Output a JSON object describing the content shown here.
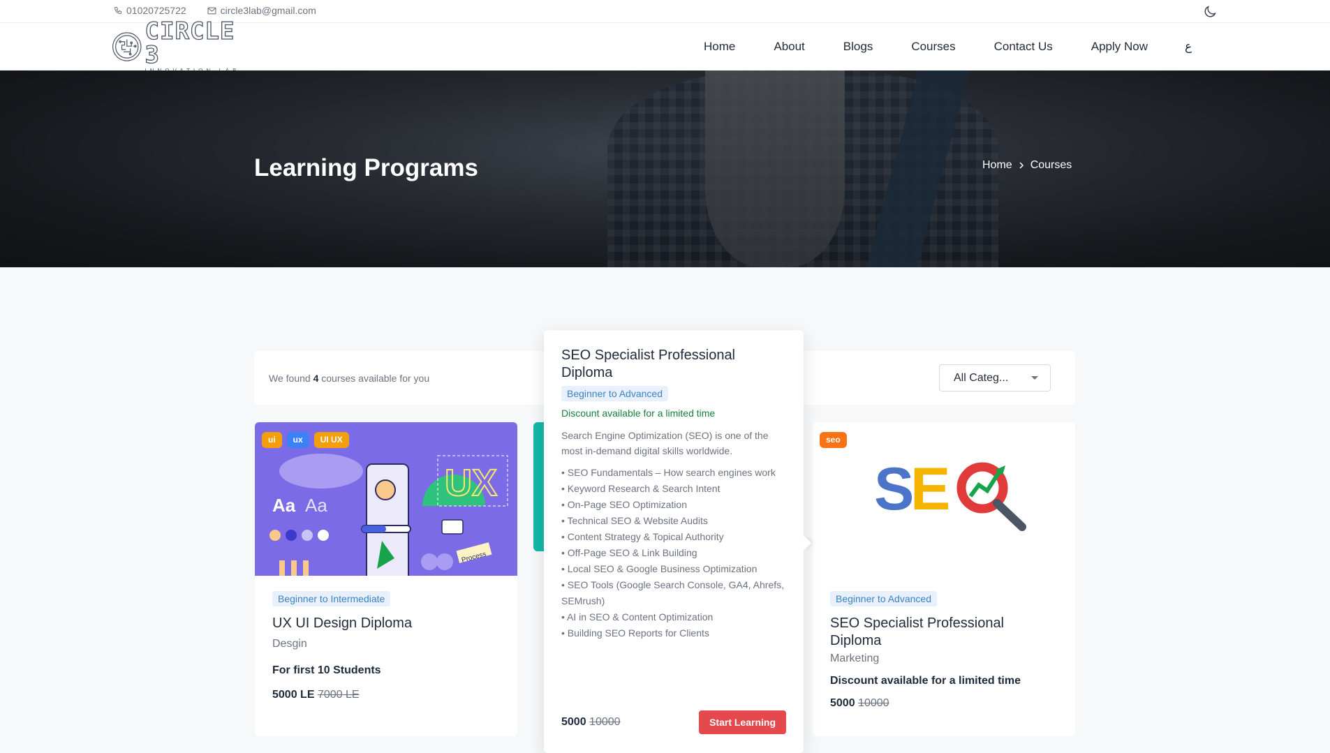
{
  "topbar": {
    "phone": "01020725722",
    "email": "circle3lab@gmail.com",
    "theme_toggle_icon": "moon-icon"
  },
  "logo": {
    "main": "CIRCLE 3",
    "sub": "INNOVATION LAB"
  },
  "nav": {
    "items": [
      "Home",
      "About",
      "Blogs",
      "Courses",
      "Contact Us",
      "Apply Now"
    ],
    "lang": "ع"
  },
  "hero": {
    "title": "Learning Programs",
    "breadcrumb": [
      "Home",
      "Courses"
    ]
  },
  "filter": {
    "found_prefix": "We found",
    "count": "4",
    "found_suffix": "courses available for you",
    "category_select": "All Categ..."
  },
  "cards": [
    {
      "tags": [
        "ui",
        "ux",
        "UI UX"
      ],
      "level": "Beginner to Intermediate",
      "title": "UX UI Design Diploma",
      "category": "Desgin",
      "note": "For first 10 Students",
      "price": "5000 LE",
      "old_price": "7000 LE"
    },
    {
      "tags": [
        "seo"
      ],
      "level": "Beginner to Advanced",
      "title": "SEO Specialist Professional Diploma",
      "category": "Marketing",
      "note": "Discount available for a limited time",
      "price": "5000",
      "old_price": "10000"
    }
  ],
  "popover": {
    "title": "SEO Specialist Professional Diploma",
    "level": "Beginner to Advanced",
    "discount": "Discount available for a limited time",
    "description": "Search Engine Optimization (SEO) is one of the most in-demand digital skills worldwide.",
    "topics": [
      "SEO Fundamentals – How search engines work",
      "Keyword Research & Search Intent",
      "On-Page SEO Optimization",
      "Technical SEO & Website Audits",
      "Content Strategy & Topical Authority",
      "Off-Page SEO & Link Building",
      "Local SEO & Google Business Optimization",
      "SEO Tools (Google Search Console, GA4, Ahrefs, SEMrush)",
      "AI in SEO & Content Optimization",
      "Building SEO Reports for Clients"
    ],
    "price": "5000",
    "old_price": "10000",
    "cta": "Start Learning"
  },
  "colors": {
    "accent_red": "#e5484d",
    "level_blue": "#3b82c4",
    "discount_green": "#15803d",
    "ui_purple": "#7c6be6"
  }
}
